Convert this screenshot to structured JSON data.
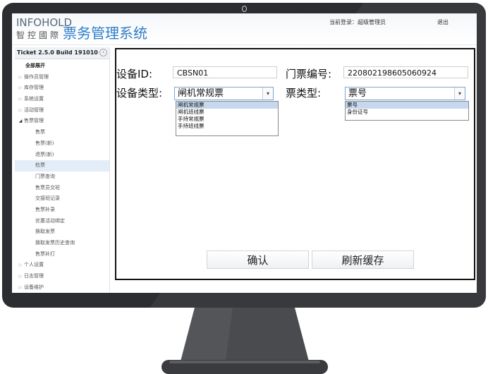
{
  "header": {
    "logo_en": "INFOHOLD",
    "logo_cn": "智控國際",
    "system_title": "票务管理系统",
    "current_user": "当前登录：超级管理员",
    "logout": "退出"
  },
  "sidebar": {
    "build": "Ticket 2.5.0 Build 191010",
    "collapse_icon": "chevron-left-icon",
    "items": [
      {
        "label": "全部展开"
      },
      {
        "label": "操作员管理"
      },
      {
        "label": "库存管理"
      },
      {
        "label": "系统设置"
      },
      {
        "label": "活动管理"
      },
      {
        "label": "售票管理"
      },
      {
        "label": "售票"
      },
      {
        "label": "售票(新)"
      },
      {
        "label": "退票(新)"
      },
      {
        "label": "检票"
      },
      {
        "label": "门票查询"
      },
      {
        "label": "售票员交班"
      },
      {
        "label": "交接班记录"
      },
      {
        "label": "售票补录"
      },
      {
        "label": "优惠活动绑定"
      },
      {
        "label": "换取发票"
      },
      {
        "label": "换取发票历史查询"
      },
      {
        "label": "售票补打"
      },
      {
        "label": "个人设置"
      },
      {
        "label": "日志管理"
      },
      {
        "label": "设备维护"
      }
    ]
  },
  "form": {
    "device_id_label": "设备ID:",
    "device_id_value": "CBSN01",
    "ticket_no_label": "门票编号:",
    "ticket_no_value": "220802198605060924",
    "device_type_label": "设备类型:",
    "device_type_value": "闸机常规票",
    "device_type_options": [
      "闸机常规票",
      "闸机班线票",
      "手持常规票",
      "手持班线票"
    ],
    "ticket_type_label": "票类型:",
    "ticket_type_value": "票号",
    "ticket_type_options": [
      "票号",
      "身份证号"
    ]
  },
  "buttons": {
    "confirm": "确认",
    "refresh_cache": "刷新缓存"
  },
  "colors": {
    "accent": "#2f7ec9",
    "bezel": "#2b2d30",
    "selected_option": "#c6d8ee"
  }
}
